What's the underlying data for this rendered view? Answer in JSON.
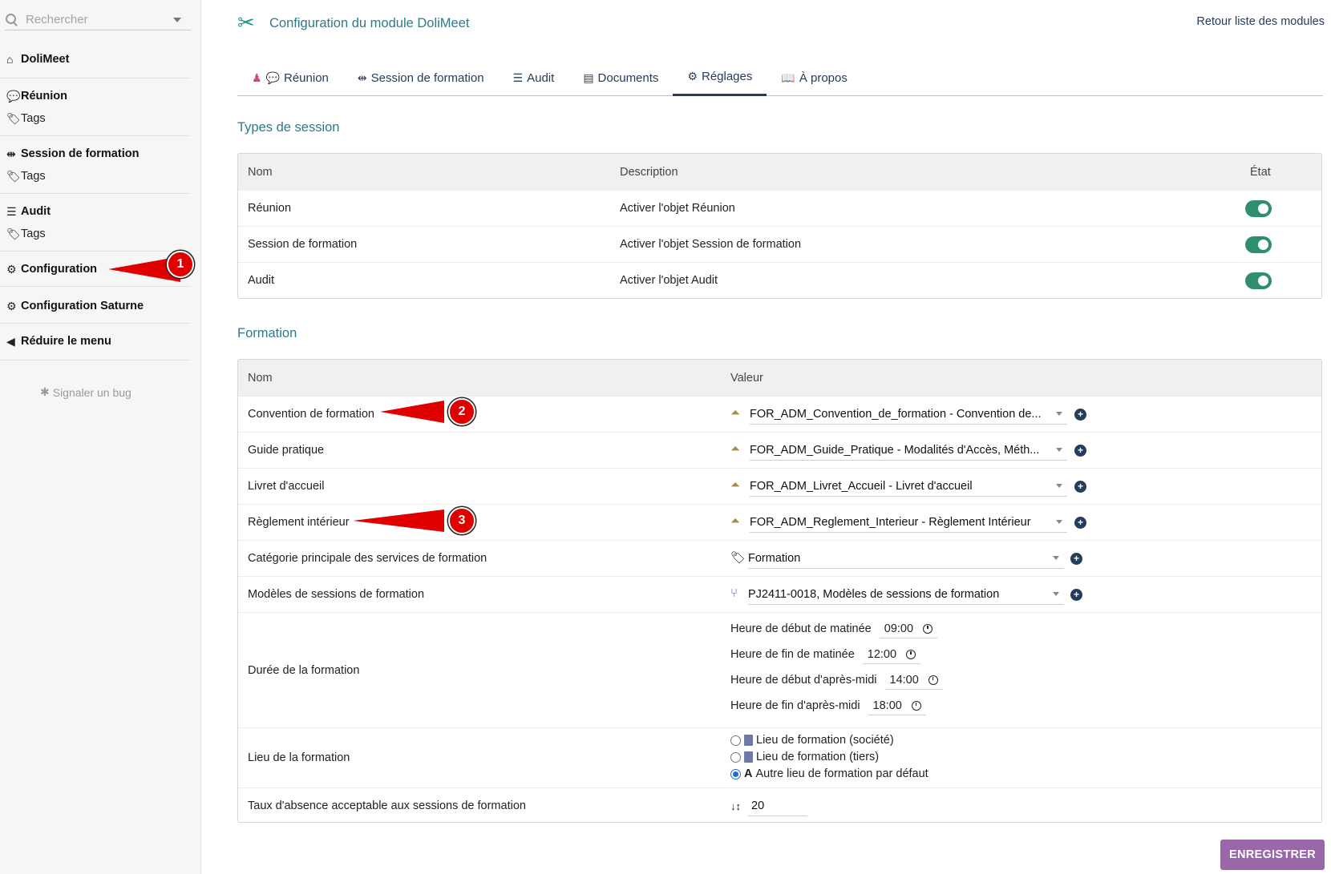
{
  "sidebar": {
    "search_placeholder": "Rechercher",
    "items": [
      {
        "label": "DoliMeet",
        "icon": "home-icon"
      },
      {
        "label": "Réunion",
        "icon": "comments-icon"
      },
      {
        "label": "Tags",
        "icon": "tags-icon"
      },
      {
        "label": "Session de formation",
        "icon": "people-arrows-icon"
      },
      {
        "label": "Tags",
        "icon": "tags-icon"
      },
      {
        "label": "Audit",
        "icon": "tasks-icon"
      },
      {
        "label": "Tags",
        "icon": "tags-icon"
      },
      {
        "label": "Configuration",
        "icon": "gear-icon"
      },
      {
        "label": "Configuration Saturne",
        "icon": "gear-icon"
      },
      {
        "label": "Réduire le menu",
        "icon": "chevron-circle-left-icon"
      }
    ],
    "bug_label": "Signaler un bug"
  },
  "header": {
    "title": "Configuration du module DoliMeet",
    "back_link": "Retour liste des modules"
  },
  "tabs": [
    {
      "label": "Réunion",
      "icon": "comments-icon",
      "active": false
    },
    {
      "label": "Session de formation",
      "icon": "people-arrows-icon",
      "active": false
    },
    {
      "label": "Audit",
      "icon": "tasks-icon",
      "active": false
    },
    {
      "label": "Documents",
      "icon": "file-icon",
      "active": false
    },
    {
      "label": "Réglages",
      "icon": "gear-icon",
      "active": true
    },
    {
      "label": "À propos",
      "icon": "book-open-icon",
      "active": false
    }
  ],
  "session_types": {
    "title": "Types de session",
    "headers": {
      "name": "Nom",
      "description": "Description",
      "state": "État"
    },
    "rows": [
      {
        "name": "Réunion",
        "description": "Activer l'objet Réunion",
        "enabled": true
      },
      {
        "name": "Session de formation",
        "description": "Activer l'objet Session de formation",
        "enabled": true
      },
      {
        "name": "Audit",
        "description": "Activer l'objet Audit",
        "enabled": true
      }
    ]
  },
  "formation": {
    "title": "Formation",
    "headers": {
      "name": "Nom",
      "value": "Valeur"
    },
    "rows": {
      "convention": {
        "name": "Convention de formation",
        "value": "FOR_ADM_Convention_de_formation - Convention de..."
      },
      "guide": {
        "name": "Guide pratique",
        "value": "FOR_ADM_Guide_Pratique - Modalités d'Accès, Méth..."
      },
      "livret": {
        "name": "Livret d'accueil",
        "value": "FOR_ADM_Livret_Accueil - Livret d'accueil"
      },
      "reglement": {
        "name": "Règlement intérieur",
        "value": "FOR_ADM_Reglement_Interieur - Règlement Intérieur"
      },
      "categorie": {
        "name": "Catégorie principale des services de formation",
        "value": "Formation"
      },
      "modeles": {
        "name": "Modèles de sessions de formation",
        "value": "PJ2411-0018, Modèles de sessions de formation"
      },
      "duree": {
        "name": "Durée de la formation",
        "times": [
          {
            "label": "Heure de début de matinée",
            "value": "09:00"
          },
          {
            "label": "Heure de fin de matinée",
            "value": "12:00"
          },
          {
            "label": "Heure de début d'après-midi",
            "value": "14:00"
          },
          {
            "label": "Heure de fin d'après-midi",
            "value": "18:00"
          }
        ]
      },
      "lieu": {
        "name": "Lieu de la formation",
        "options": [
          {
            "label": "Lieu de formation (société)",
            "checked": false
          },
          {
            "label": "Lieu de formation (tiers)",
            "checked": false
          },
          {
            "label": "Autre lieu de formation par défaut",
            "checked": true
          }
        ]
      },
      "taux": {
        "name": "Taux d'absence acceptable aux sessions de formation",
        "value": "20"
      }
    }
  },
  "save_button": "ENREGISTRER",
  "annotations": [
    "1",
    "2",
    "3"
  ],
  "colors": {
    "accent": "#2b7b8a",
    "nav": "#263c5c",
    "toggle_on": "#2e8e6f",
    "save": "#9a67a8",
    "callout": "#e00000"
  }
}
